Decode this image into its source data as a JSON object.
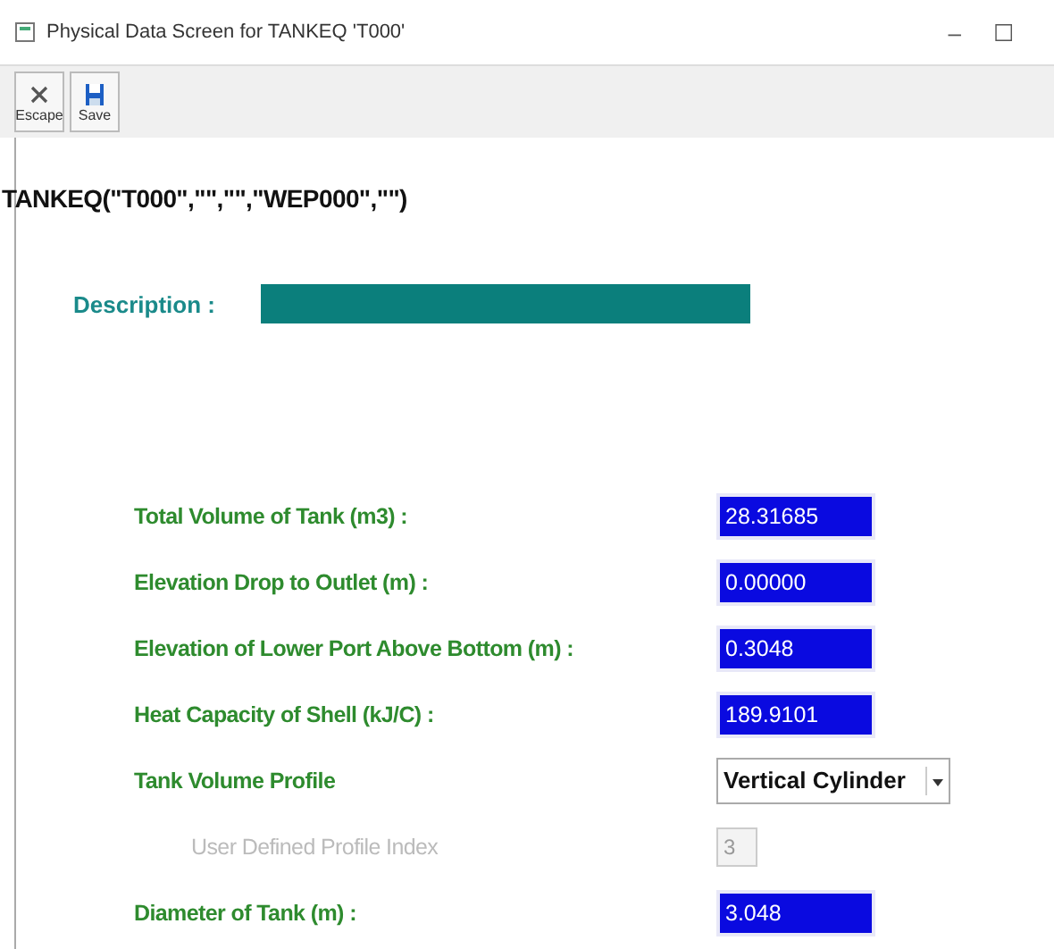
{
  "window": {
    "title": "Physical Data Screen for TANKEQ 'T000'",
    "controls": [
      "–",
      "☐"
    ]
  },
  "toolbar": [
    {
      "label": "Escape",
      "kind": "escape"
    },
    {
      "label": "Save",
      "kind": "save"
    }
  ],
  "heading": "TANKEQ(\"T000\",\"\",\"\",\"WEP000\",\"\")",
  "description": {
    "label": "Description :"
  },
  "fields": [
    {
      "kind": "number",
      "label": "Total Volume of Tank (m3) :",
      "value": "28.31685"
    },
    {
      "kind": "number",
      "label": "Elevation Drop to Outlet (m) :",
      "value": "0.00000"
    },
    {
      "kind": "number",
      "label": "Elevation of Lower Port Above Bottom (m) :",
      "value": "0.3048"
    },
    {
      "kind": "number",
      "label": "Heat Capacity of Shell (kJ/C) :",
      "value": "189.9101"
    },
    {
      "kind": "select",
      "label": "Tank Volume Profile",
      "value": "Vertical Cylinder"
    },
    {
      "kind": "disabled",
      "label": "User Defined Profile Index",
      "value": "3"
    },
    {
      "kind": "number",
      "label": "Diameter of Tank (m) :",
      "value": "3.048"
    }
  ]
}
